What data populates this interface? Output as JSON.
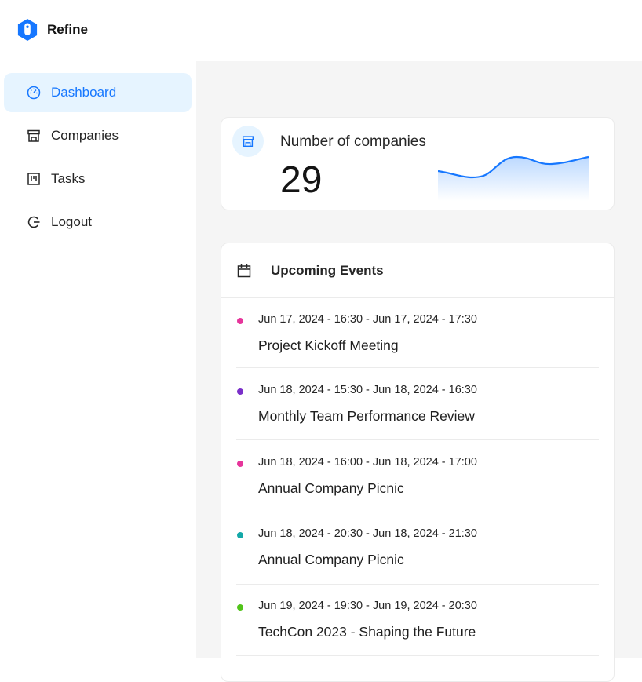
{
  "app": {
    "name": "Refine",
    "accent": "#1677ff"
  },
  "sidebar": {
    "items": [
      {
        "label": "Dashboard",
        "icon": "dashboard-icon",
        "active": true
      },
      {
        "label": "Companies",
        "icon": "shop-icon",
        "active": false
      },
      {
        "label": "Tasks",
        "icon": "kanban-icon",
        "active": false
      },
      {
        "label": "Logout",
        "icon": "logout-icon",
        "active": false
      }
    ]
  },
  "stats": {
    "label": "Number of companies",
    "value": "29",
    "icon": "shop-icon"
  },
  "events": {
    "title": "Upcoming Events",
    "icon": "calendar-icon",
    "items": [
      {
        "time": "Jun 17, 2024 - 16:30 - Jun 17, 2024 - 17:30",
        "name": "Project Kickoff Meeting",
        "color": "#e6359b"
      },
      {
        "time": "Jun 18, 2024 - 15:30 - Jun 18, 2024 - 16:30",
        "name": "Monthly Team Performance Review",
        "color": "#7a2fc9"
      },
      {
        "time": "Jun 18, 2024 - 16:00 - Jun 18, 2024 - 17:00",
        "name": "Annual Company Picnic",
        "color": "#e6359b"
      },
      {
        "time": "Jun 18, 2024 - 20:30 - Jun 18, 2024 - 21:30",
        "name": "Annual Company Picnic",
        "color": "#13a8a8"
      },
      {
        "time": "Jun 19, 2024 - 19:30 - Jun 19, 2024 - 20:30",
        "name": "TechCon 2023 - Shaping the Future",
        "color": "#52c41a"
      }
    ]
  }
}
